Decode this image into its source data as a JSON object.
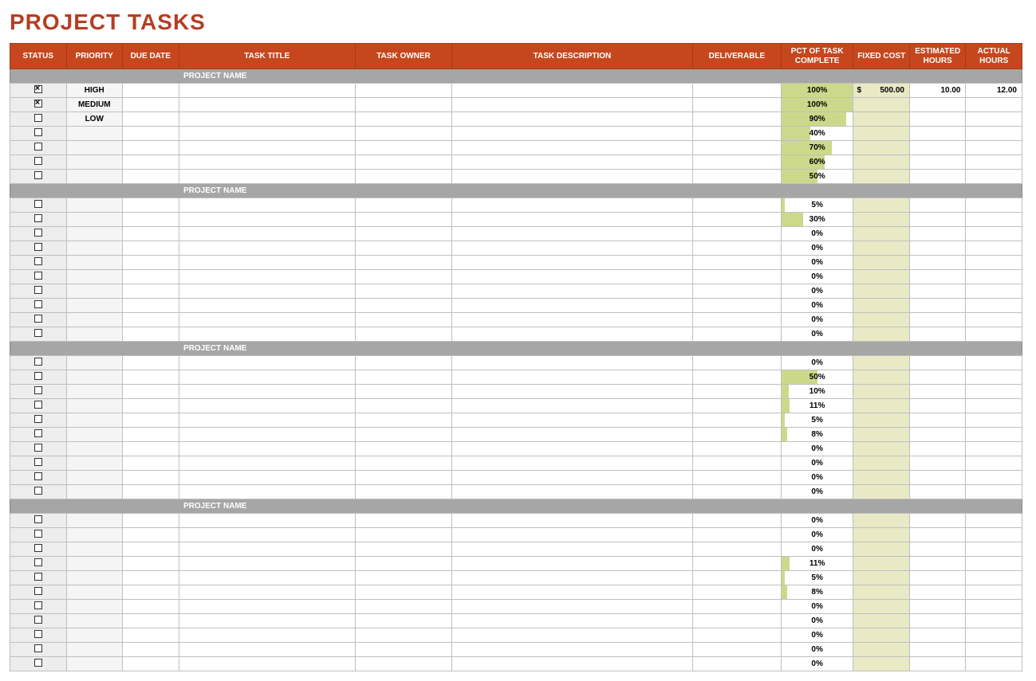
{
  "title": "PROJECT TASKS",
  "columns": {
    "status": "STATUS",
    "priority": "PRIORITY",
    "due_date": "DUE DATE",
    "task_title": "TASK TITLE",
    "task_owner": "TASK OWNER",
    "task_description": "TASK DESCRIPTION",
    "deliverable": "DELIVERABLE",
    "pct_complete": "PCT OF TASK COMPLETE",
    "fixed_cost": "FIXED COST",
    "estimated_hours": "ESTIMATED HOURS",
    "actual_hours": "ACTUAL HOURS"
  },
  "groups": [
    {
      "name": "PROJECT NAME",
      "rows": [
        {
          "status": true,
          "priority": "HIGH",
          "due_date": "",
          "title": "",
          "owner": "",
          "desc": "",
          "deliverable": "",
          "pct": 100,
          "cost_symbol": "$",
          "cost": "500.00",
          "est": "10.00",
          "act": "12.00"
        },
        {
          "status": true,
          "priority": "MEDIUM",
          "due_date": "",
          "title": "",
          "owner": "",
          "desc": "",
          "deliverable": "",
          "pct": 100,
          "cost_symbol": "",
          "cost": "",
          "est": "",
          "act": ""
        },
        {
          "status": false,
          "priority": "LOW",
          "due_date": "",
          "title": "",
          "owner": "",
          "desc": "",
          "deliverable": "",
          "pct": 90,
          "cost_symbol": "",
          "cost": "",
          "est": "",
          "act": ""
        },
        {
          "status": false,
          "priority": "",
          "due_date": "",
          "title": "",
          "owner": "",
          "desc": "",
          "deliverable": "",
          "pct": 40,
          "cost_symbol": "",
          "cost": "",
          "est": "",
          "act": ""
        },
        {
          "status": false,
          "priority": "",
          "due_date": "",
          "title": "",
          "owner": "",
          "desc": "",
          "deliverable": "",
          "pct": 70,
          "cost_symbol": "",
          "cost": "",
          "est": "",
          "act": ""
        },
        {
          "status": false,
          "priority": "",
          "due_date": "",
          "title": "",
          "owner": "",
          "desc": "",
          "deliverable": "",
          "pct": 60,
          "cost_symbol": "",
          "cost": "",
          "est": "",
          "act": ""
        },
        {
          "status": false,
          "priority": "",
          "due_date": "",
          "title": "",
          "owner": "",
          "desc": "",
          "deliverable": "",
          "pct": 50,
          "cost_symbol": "",
          "cost": "",
          "est": "",
          "act": ""
        }
      ]
    },
    {
      "name": "PROJECT NAME",
      "rows": [
        {
          "status": false,
          "priority": "",
          "due_date": "",
          "title": "",
          "owner": "",
          "desc": "",
          "deliverable": "",
          "pct": 5,
          "cost_symbol": "",
          "cost": "",
          "est": "",
          "act": ""
        },
        {
          "status": false,
          "priority": "",
          "due_date": "",
          "title": "",
          "owner": "",
          "desc": "",
          "deliverable": "",
          "pct": 30,
          "cost_symbol": "",
          "cost": "",
          "est": "",
          "act": ""
        },
        {
          "status": false,
          "priority": "",
          "due_date": "",
          "title": "",
          "owner": "",
          "desc": "",
          "deliverable": "",
          "pct": 0,
          "cost_symbol": "",
          "cost": "",
          "est": "",
          "act": ""
        },
        {
          "status": false,
          "priority": "",
          "due_date": "",
          "title": "",
          "owner": "",
          "desc": "",
          "deliverable": "",
          "pct": 0,
          "cost_symbol": "",
          "cost": "",
          "est": "",
          "act": ""
        },
        {
          "status": false,
          "priority": "",
          "due_date": "",
          "title": "",
          "owner": "",
          "desc": "",
          "deliverable": "",
          "pct": 0,
          "cost_symbol": "",
          "cost": "",
          "est": "",
          "act": ""
        },
        {
          "status": false,
          "priority": "",
          "due_date": "",
          "title": "",
          "owner": "",
          "desc": "",
          "deliverable": "",
          "pct": 0,
          "cost_symbol": "",
          "cost": "",
          "est": "",
          "act": ""
        },
        {
          "status": false,
          "priority": "",
          "due_date": "",
          "title": "",
          "owner": "",
          "desc": "",
          "deliverable": "",
          "pct": 0,
          "cost_symbol": "",
          "cost": "",
          "est": "",
          "act": ""
        },
        {
          "status": false,
          "priority": "",
          "due_date": "",
          "title": "",
          "owner": "",
          "desc": "",
          "deliverable": "",
          "pct": 0,
          "cost_symbol": "",
          "cost": "",
          "est": "",
          "act": ""
        },
        {
          "status": false,
          "priority": "",
          "due_date": "",
          "title": "",
          "owner": "",
          "desc": "",
          "deliverable": "",
          "pct": 0,
          "cost_symbol": "",
          "cost": "",
          "est": "",
          "act": ""
        },
        {
          "status": false,
          "priority": "",
          "due_date": "",
          "title": "",
          "owner": "",
          "desc": "",
          "deliverable": "",
          "pct": 0,
          "cost_symbol": "",
          "cost": "",
          "est": "",
          "act": ""
        }
      ]
    },
    {
      "name": "PROJECT NAME",
      "rows": [
        {
          "status": false,
          "priority": "",
          "due_date": "",
          "title": "",
          "owner": "",
          "desc": "",
          "deliverable": "",
          "pct": 0,
          "cost_symbol": "",
          "cost": "",
          "est": "",
          "act": ""
        },
        {
          "status": false,
          "priority": "",
          "due_date": "",
          "title": "",
          "owner": "",
          "desc": "",
          "deliverable": "",
          "pct": 50,
          "cost_symbol": "",
          "cost": "",
          "est": "",
          "act": ""
        },
        {
          "status": false,
          "priority": "",
          "due_date": "",
          "title": "",
          "owner": "",
          "desc": "",
          "deliverable": "",
          "pct": 10,
          "cost_symbol": "",
          "cost": "",
          "est": "",
          "act": ""
        },
        {
          "status": false,
          "priority": "",
          "due_date": "",
          "title": "",
          "owner": "",
          "desc": "",
          "deliverable": "",
          "pct": 11,
          "cost_symbol": "",
          "cost": "",
          "est": "",
          "act": ""
        },
        {
          "status": false,
          "priority": "",
          "due_date": "",
          "title": "",
          "owner": "",
          "desc": "",
          "deliverable": "",
          "pct": 5,
          "cost_symbol": "",
          "cost": "",
          "est": "",
          "act": ""
        },
        {
          "status": false,
          "priority": "",
          "due_date": "",
          "title": "",
          "owner": "",
          "desc": "",
          "deliverable": "",
          "pct": 8,
          "cost_symbol": "",
          "cost": "",
          "est": "",
          "act": ""
        },
        {
          "status": false,
          "priority": "",
          "due_date": "",
          "title": "",
          "owner": "",
          "desc": "",
          "deliverable": "",
          "pct": 0,
          "cost_symbol": "",
          "cost": "",
          "est": "",
          "act": ""
        },
        {
          "status": false,
          "priority": "",
          "due_date": "",
          "title": "",
          "owner": "",
          "desc": "",
          "deliverable": "",
          "pct": 0,
          "cost_symbol": "",
          "cost": "",
          "est": "",
          "act": ""
        },
        {
          "status": false,
          "priority": "",
          "due_date": "",
          "title": "",
          "owner": "",
          "desc": "",
          "deliverable": "",
          "pct": 0,
          "cost_symbol": "",
          "cost": "",
          "est": "",
          "act": ""
        },
        {
          "status": false,
          "priority": "",
          "due_date": "",
          "title": "",
          "owner": "",
          "desc": "",
          "deliverable": "",
          "pct": 0,
          "cost_symbol": "",
          "cost": "",
          "est": "",
          "act": ""
        }
      ]
    },
    {
      "name": "PROJECT NAME",
      "rows": [
        {
          "status": false,
          "priority": "",
          "due_date": "",
          "title": "",
          "owner": "",
          "desc": "",
          "deliverable": "",
          "pct": 0,
          "cost_symbol": "",
          "cost": "",
          "est": "",
          "act": ""
        },
        {
          "status": false,
          "priority": "",
          "due_date": "",
          "title": "",
          "owner": "",
          "desc": "",
          "deliverable": "",
          "pct": 0,
          "cost_symbol": "",
          "cost": "",
          "est": "",
          "act": ""
        },
        {
          "status": false,
          "priority": "",
          "due_date": "",
          "title": "",
          "owner": "",
          "desc": "",
          "deliverable": "",
          "pct": 0,
          "cost_symbol": "",
          "cost": "",
          "est": "",
          "act": ""
        },
        {
          "status": false,
          "priority": "",
          "due_date": "",
          "title": "",
          "owner": "",
          "desc": "",
          "deliverable": "",
          "pct": 11,
          "cost_symbol": "",
          "cost": "",
          "est": "",
          "act": ""
        },
        {
          "status": false,
          "priority": "",
          "due_date": "",
          "title": "",
          "owner": "",
          "desc": "",
          "deliverable": "",
          "pct": 5,
          "cost_symbol": "",
          "cost": "",
          "est": "",
          "act": ""
        },
        {
          "status": false,
          "priority": "",
          "due_date": "",
          "title": "",
          "owner": "",
          "desc": "",
          "deliverable": "",
          "pct": 8,
          "cost_symbol": "",
          "cost": "",
          "est": "",
          "act": ""
        },
        {
          "status": false,
          "priority": "",
          "due_date": "",
          "title": "",
          "owner": "",
          "desc": "",
          "deliverable": "",
          "pct": 0,
          "cost_symbol": "",
          "cost": "",
          "est": "",
          "act": ""
        },
        {
          "status": false,
          "priority": "",
          "due_date": "",
          "title": "",
          "owner": "",
          "desc": "",
          "deliverable": "",
          "pct": 0,
          "cost_symbol": "",
          "cost": "",
          "est": "",
          "act": ""
        },
        {
          "status": false,
          "priority": "",
          "due_date": "",
          "title": "",
          "owner": "",
          "desc": "",
          "deliverable": "",
          "pct": 0,
          "cost_symbol": "",
          "cost": "",
          "est": "",
          "act": ""
        },
        {
          "status": false,
          "priority": "",
          "due_date": "",
          "title": "",
          "owner": "",
          "desc": "",
          "deliverable": "",
          "pct": 0,
          "cost_symbol": "",
          "cost": "",
          "est": "",
          "act": ""
        },
        {
          "status": false,
          "priority": "",
          "due_date": "",
          "title": "",
          "owner": "",
          "desc": "",
          "deliverable": "",
          "pct": 0,
          "cost_symbol": "",
          "cost": "",
          "est": "",
          "act": ""
        }
      ]
    }
  ]
}
